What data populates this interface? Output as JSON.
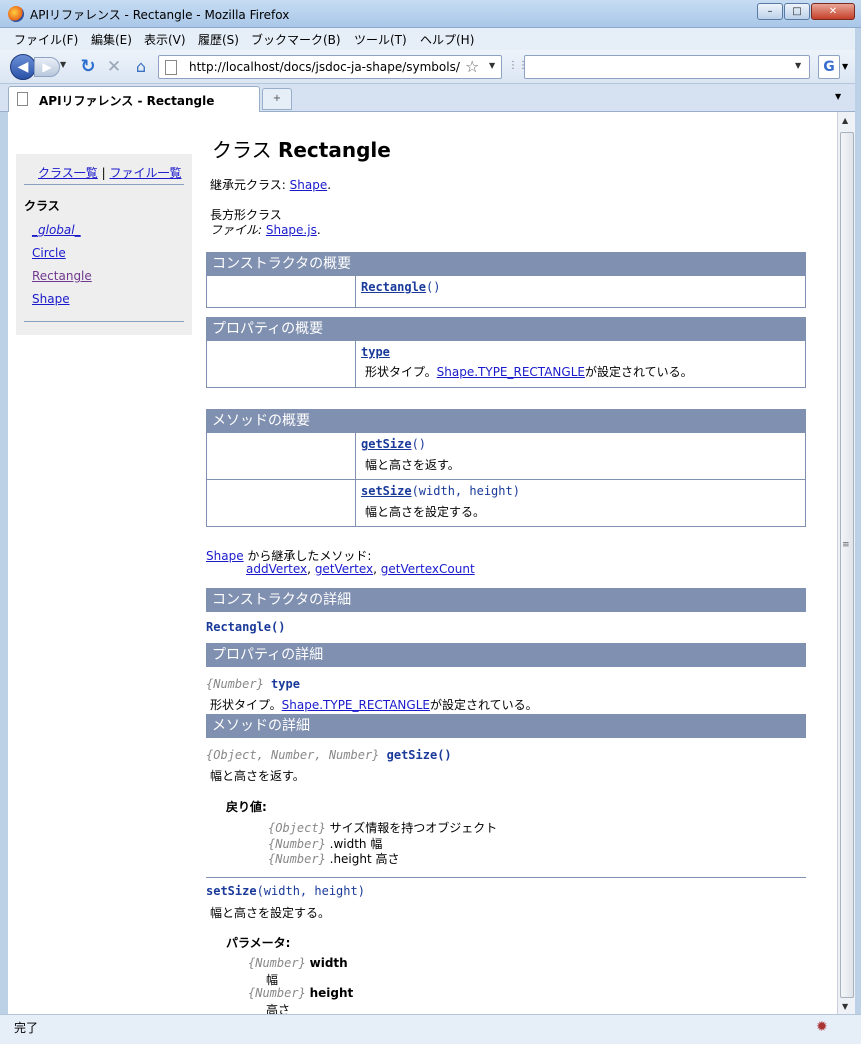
{
  "window": {
    "title": "APIリファレンス - Rectangle - Mozilla Firefox",
    "min": "–",
    "max": "□",
    "close": "✕"
  },
  "menu": [
    "ファイル(F)",
    "編集(E)",
    "表示(V)",
    "履歴(S)",
    "ブックマーク(B)",
    "ツール(T)",
    "ヘルプ(H)"
  ],
  "nav": {
    "url": "http://localhost/docs/jsdoc-ja-shape/symbols/R",
    "search_placeholder": ""
  },
  "tabs": [
    {
      "label": "APIリファレンス - Rectangle"
    }
  ],
  "status": {
    "text": "完了"
  },
  "sidebar": {
    "class_list": "クラス一覧",
    "file_list": "ファイル一覧",
    "separator": "|",
    "heading": "クラス",
    "items": [
      "_global_",
      "Circle",
      "Rectangle",
      "Shape"
    ]
  },
  "page": {
    "title_prefix": "クラス ",
    "title_name": "Rectangle",
    "extends_label": "継承元クラス: ",
    "extends_link": "Shape",
    "extends_suffix": ".",
    "description": "長方形クラス",
    "file_label": "ファイル: ",
    "file_link": "Shape.js",
    "file_suffix": ".",
    "constructor_summary": {
      "heading": "コンストラクタの概要",
      "name": "Rectangle",
      "sig": "()"
    },
    "property_summary": {
      "heading": "プロパティの概要",
      "name": "type",
      "desc_prefix": "形状タイプ。",
      "desc_link": "Shape.TYPE_RECTANGLE",
      "desc_suffix": "が設定されている。"
    },
    "method_summary": {
      "heading": "メソッドの概要",
      "methods": [
        {
          "name": "getSize",
          "sig": "()",
          "desc": "幅と高さを返す。"
        },
        {
          "name": "setSize",
          "sig": "(width, height)",
          "desc": "幅と高さを設定する。"
        }
      ]
    },
    "inherited": {
      "link": "Shape",
      "text": " から継承したメソッド:",
      "methods": [
        "addVertex",
        "getVertex",
        "getVertexCount"
      ],
      "comma": ", "
    },
    "constructor_detail": {
      "heading": "コンストラクタの詳細",
      "sig": "Rectangle()"
    },
    "property_detail": {
      "heading": "プロパティの詳細",
      "type": "{Number}",
      "name": "type",
      "desc_prefix": "形状タイプ。",
      "desc_link": "Shape.TYPE_RECTANGLE",
      "desc_suffix": "が設定されている。"
    },
    "method_detail": {
      "heading": "メソッドの詳細",
      "getSize": {
        "type": "{Object, Number, Number}",
        "name": "getSize",
        "sig": "()",
        "desc": "幅と高さを返す。",
        "returns_label": "戻り値:",
        "returns": [
          {
            "type": "{Object}",
            "desc": "サイズ情報を持つオブジェクト"
          },
          {
            "type": "{Number}",
            "desc": ".width 幅"
          },
          {
            "type": "{Number}",
            "desc": ".height 高さ"
          }
        ]
      },
      "setSize": {
        "name": "setSize",
        "sig": "(width, height)",
        "desc": "幅と高さを設定する。",
        "params_label": "パラメータ:",
        "params": [
          {
            "type": "{Number}",
            "name": "width",
            "desc": "幅"
          },
          {
            "type": "{Number}",
            "name": "height",
            "desc": "高さ"
          }
        ]
      }
    }
  }
}
